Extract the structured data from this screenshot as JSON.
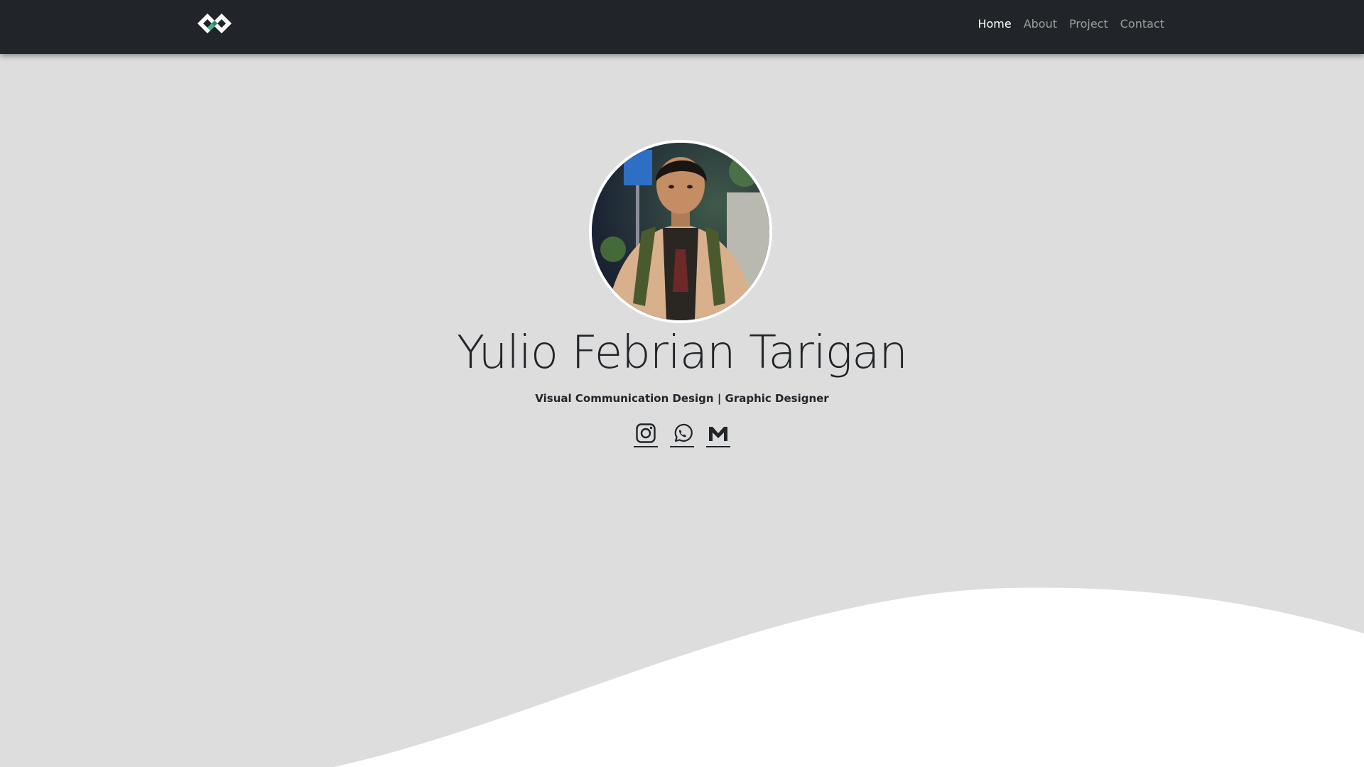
{
  "navbar": {
    "brand_icon": "monogram-logo",
    "links": [
      {
        "label": "Home",
        "active": true
      },
      {
        "label": "About",
        "active": false
      },
      {
        "label": "Project",
        "active": false
      },
      {
        "label": "Contact",
        "active": false
      }
    ]
  },
  "hero": {
    "photo_icon": "profile-photo",
    "name": "Yulio Febrian Tarigan",
    "subtitle": "Visual Communication Design | Graphic Designer",
    "social": [
      {
        "icon": "instagram-icon"
      },
      {
        "icon": "whatsapp-icon"
      },
      {
        "icon": "gmail-icon"
      }
    ]
  },
  "colors": {
    "navbar_bg": "#212529",
    "hero_bg": "#dddddd",
    "wave": "#ffffff",
    "logo_accent": "#3bb78f",
    "text_dark": "#212529"
  }
}
